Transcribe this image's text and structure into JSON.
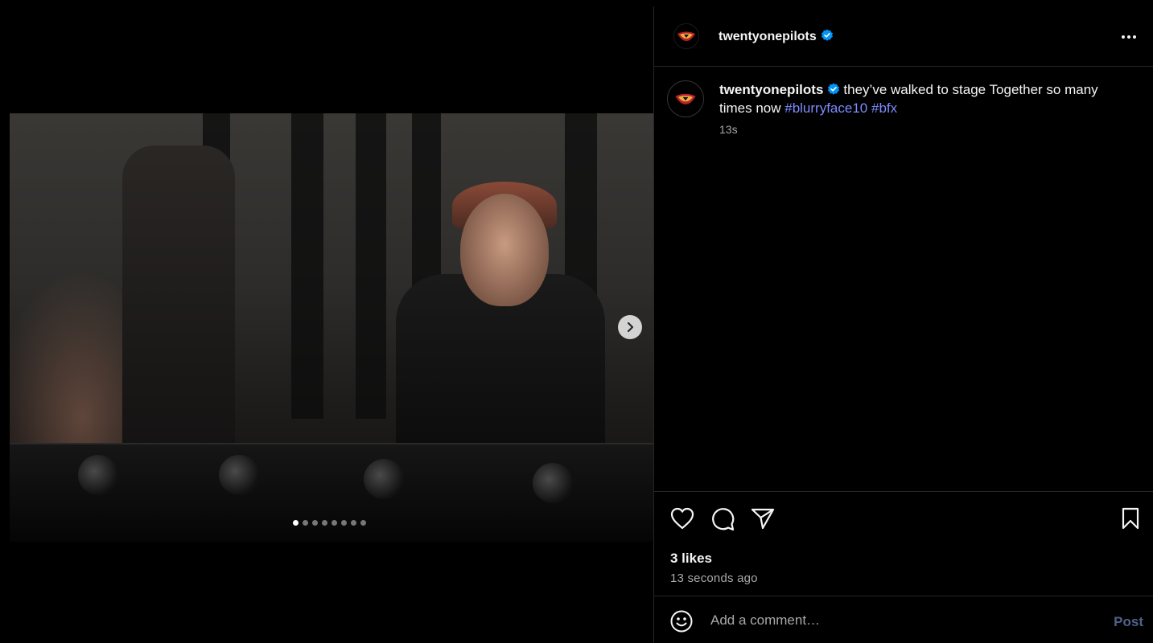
{
  "post": {
    "username": "twentyonepilots",
    "caption_prefix": "they’ve walked to stage Together so many times now ",
    "hashtags": [
      "#blurryface10",
      "#bfx"
    ],
    "time_short": "13s",
    "likes": "3 likes",
    "time_ago": "13 seconds ago",
    "carousel": {
      "count": 8,
      "active_index": 0
    }
  },
  "comment": {
    "placeholder": "Add a comment…",
    "post_label": "Post"
  },
  "icons": {
    "verified": "verified-badge-icon",
    "more": "more-options-icon",
    "like": "heart-icon",
    "comment": "comment-icon",
    "share": "share-icon",
    "save": "bookmark-icon",
    "emoji": "emoji-icon",
    "next": "chevron-right-icon"
  },
  "colors": {
    "background": "#000000",
    "text": "#f5f5f5",
    "secondary_text": "#a8a8a8",
    "hashtag": "#7c8cff",
    "verified": "#0095f6",
    "post_disabled": "#50628a",
    "divider": "#262626"
  }
}
